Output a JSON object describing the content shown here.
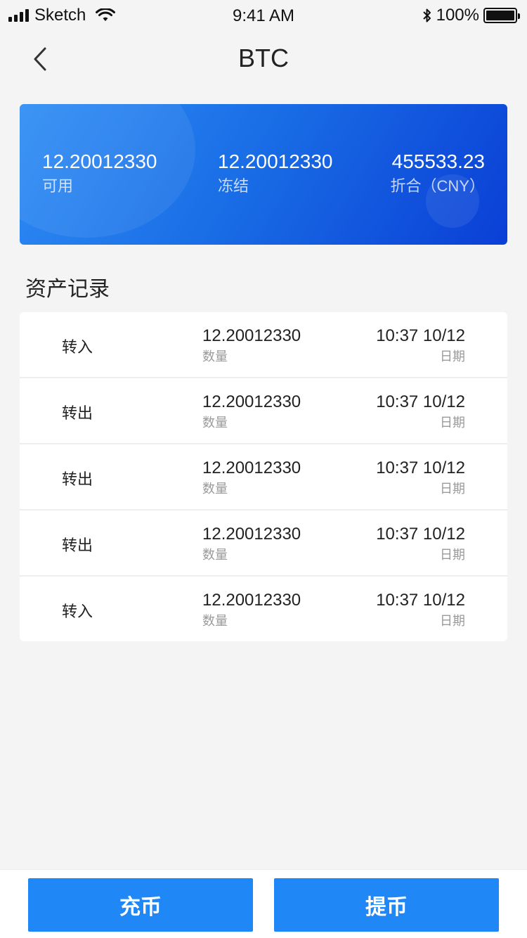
{
  "status_bar": {
    "carrier": "Sketch",
    "time": "9:41 AM",
    "battery": "100%"
  },
  "nav": {
    "title": "BTC"
  },
  "balance": {
    "available_value": "12.20012330",
    "available_label": "可用",
    "frozen_value": "12.20012330",
    "frozen_label": "冻结",
    "converted_value": "455533.23",
    "converted_label": "折合（CNY）"
  },
  "section": {
    "title": "资产记录"
  },
  "records": [
    {
      "type": "转入",
      "amount": "12.20012330",
      "amount_label": "数量",
      "date": "10:37 10/12",
      "date_label": "日期"
    },
    {
      "type": "转出",
      "amount": "12.20012330",
      "amount_label": "数量",
      "date": "10:37 10/12",
      "date_label": "日期"
    },
    {
      "type": "转出",
      "amount": "12.20012330",
      "amount_label": "数量",
      "date": "10:37 10/12",
      "date_label": "日期"
    },
    {
      "type": "转出",
      "amount": "12.20012330",
      "amount_label": "数量",
      "date": "10:37 10/12",
      "date_label": "日期"
    },
    {
      "type": "转入",
      "amount": "12.20012330",
      "amount_label": "数量",
      "date": "10:37 10/12",
      "date_label": "日期"
    }
  ],
  "actions": {
    "deposit_label": "充币",
    "withdraw_label": "提币"
  },
  "colors": {
    "accent": "#1f87f6",
    "card_gradient_start": "#2e8df4",
    "card_gradient_end": "#0a3fd6"
  },
  "icons": [
    "signal-icon",
    "wifi-icon",
    "bluetooth-icon",
    "battery-icon",
    "back-arrow-icon"
  ]
}
